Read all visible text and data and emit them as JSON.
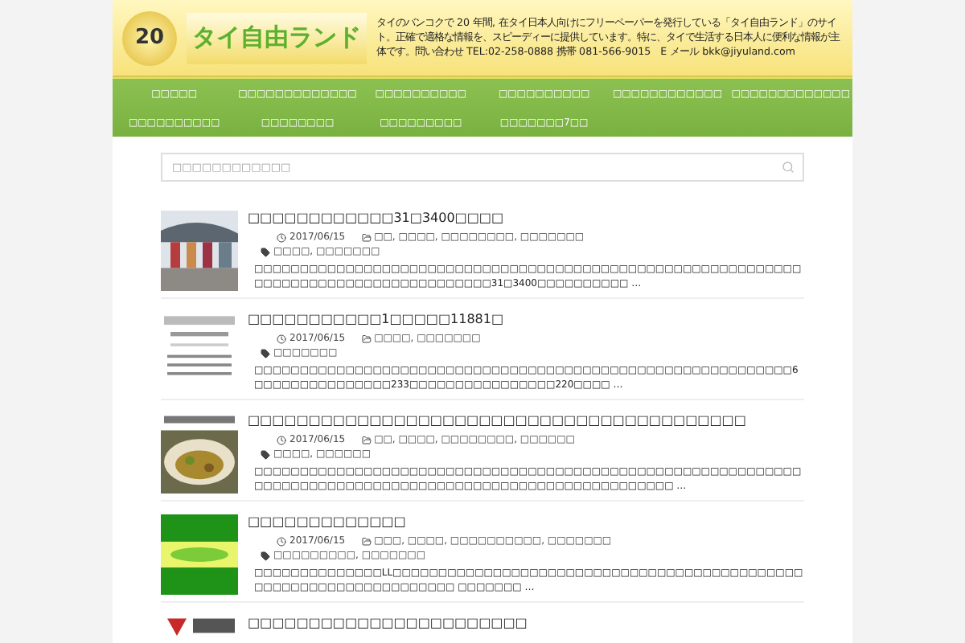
{
  "header": {
    "badge": "20",
    "logo": "タイ自由ランド",
    "intro": "タイのバンコクで 20 年間, 在タイ日本人向けにフリーペーパーを発行している「タイ自由ランド」のサイト。正確で適格な情報を、スピーディーに提供しています。特に、タイで生活する日本人に便利な情報が主体です。問い合わせ TEL:02-258-0888 携帯 081-566-9015　E メール bkk@jiyuland.com"
  },
  "nav": [
    "□□□□□",
    "□□□□□□□□□□□□□",
    "□□□□□□□□□□",
    "□□□□□□□□□□",
    "□□□□□□□□□□□□",
    "□□□□□□□□□□□□□",
    "□□□□□□□□□□",
    "□□□□□□□□",
    "□□□□□□□□□",
    "□□□□□□□7□□"
  ],
  "search": {
    "placeholder": "□□□□□□□□□□□□"
  },
  "posts": [
    {
      "title": "□□□□□□□□□□□□31□3400□□□□",
      "date": "2017/06/15",
      "categories": "□□, □□□□, □□□□□□□□, □□□□□□□",
      "tags": "□□□□, □□□□□□□",
      "excerpt": "□□□□□□□□□□□□□□□□□□□□□□□□□□□□□□□□□□□□□□□□□□□□□□□□□□□□□□□□□□□□□□□□□□□□□□□□□□□□□□□□□□□□□□31□3400□□□□□□□□□□ …"
    },
    {
      "title": "□□□□□□□□□□□1□□□□□11881□",
      "date": "2017/06/15",
      "categories": "□□□□, □□□□□□□",
      "tags": "□□□□□□□",
      "excerpt": "□□□□□□□□□□□□□□□□□□□□□□□□□□□□□□□□□□□□□□□□□□□□□□□□□□□□□□□□□□□6□□□□□□□□□□□□□□□233□□□□□□□□□□□□□□□□220□□□□ …"
    },
    {
      "title": "□□□□□□□□□□□□□□□□□□□□□□□□□□□□□□□□□□□□□□□□□",
      "date": "2017/06/15",
      "categories": "□□, □□□□, □□□□□□□□, □□□□□□",
      "tags": "□□□□, □□□□□□",
      "excerpt": "□□□□□□□□□□□□□□□□□□□□□□□□□□□□□□□□□□□□□□□□□□□□□□□□□□□□□□□□□□□□□□□□□□□□□□□□□□□□□□□□□□□□□□□□□□□□□□□□□□□□□□□□□□ …"
    },
    {
      "title": "□□□□□□□□□□□□□",
      "date": "2017/06/15",
      "categories": "□□□, □□□□, □□□□□□□□□□, □□□□□□□",
      "tags": "□□□□□□□□□, □□□□□□□",
      "excerpt": "□□□□□□□□□□□□□□LL□□□□□□□□□□□□□□□□□□□□□□□□□□□□□□□□□□□□□□□□□□□□□□□□□□□□□□□□□□□□□□□□□□□ □□□□□□□ …"
    },
    {
      "title": "□□□□□□□□□□□□□□□□□□□□□□□"
    }
  ]
}
